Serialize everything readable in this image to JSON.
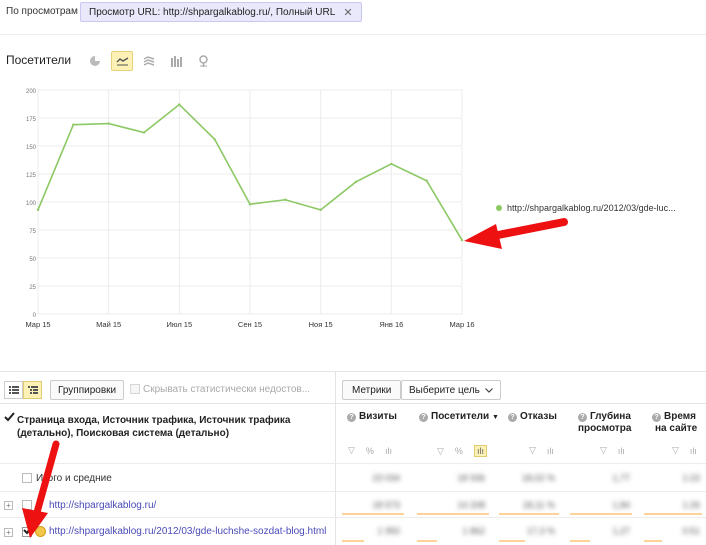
{
  "filter": {
    "label": "По просмотрам",
    "chip_text": "Просмотр URL: http://shpargalkablog.ru/, Полный URL",
    "close_glyph": "✕"
  },
  "visitors": {
    "title": "Посетители",
    "view_icons": [
      "pie-chart-icon",
      "line-chart-icon",
      "area-chart-icon",
      "bar-chart-icon",
      "map-pin-icon"
    ],
    "active_view": "line-chart-icon"
  },
  "chart_data": {
    "type": "line",
    "x_tick_labels": [
      "Мар 15",
      "Май 15",
      "Июл 15",
      "Сен 15",
      "Ноя 15",
      "Янв 16",
      "Мар 16"
    ],
    "y_tick_labels": [
      "0",
      "25",
      "50",
      "75",
      "100",
      "125",
      "150",
      "175",
      "200"
    ],
    "ylim": [
      0,
      200
    ],
    "grid": true,
    "legend_position": "right",
    "series": [
      {
        "name": "http://shpargalkablog.ru/2012/03/gde-luc...",
        "color": "#8cc864",
        "x": [
          "Мар 15",
          "Апр 15",
          "Май 15",
          "Июн 15",
          "Июл 15",
          "Авг 15",
          "Сен 15",
          "Окт 15",
          "Ноя 15",
          "Дек 15",
          "Янв 16",
          "Фев 16",
          "Мар 16"
        ],
        "values": [
          93,
          169,
          170,
          162,
          187,
          156,
          98,
          102,
          93,
          118,
          134,
          119,
          66
        ]
      }
    ]
  },
  "toolbar": {
    "groupings_label": "Группировки",
    "hide_label": "Скрывать статистически недостов...",
    "metrics_label": "Метрики",
    "goal_label": "Выберите цель"
  },
  "table": {
    "dimension_title": "Страница входа, Источник трафика, Источник трафика (детально), Поисковая система (детально)",
    "columns": [
      {
        "label": "Визиты",
        "line2": ""
      },
      {
        "label": "Посетители",
        "line2": ""
      },
      {
        "label": "Отказы",
        "line2": ""
      },
      {
        "label": "Глубина",
        "line2": "просмотра"
      },
      {
        "label": "Время",
        "line2": "на сайте"
      }
    ],
    "sort_glyph": "▼",
    "totals_label": "Итого и средние",
    "totals_values": [
      "23 034",
      "18 936",
      "18,02 %",
      "1,77",
      "1:23"
    ],
    "rows": [
      {
        "label": "http://shpargalkablog.ru/",
        "values": [
          "18 573",
          "14 208",
          "18,11 %",
          "1,84",
          "1:26"
        ]
      },
      {
        "label": "http://shpargalkablog.ru/2012/03/gde-luchshe-sozdat-blog.html",
        "values": [
          "1 950",
          "1 862",
          "17,3 %",
          "1,27",
          "0:51"
        ]
      }
    ]
  }
}
